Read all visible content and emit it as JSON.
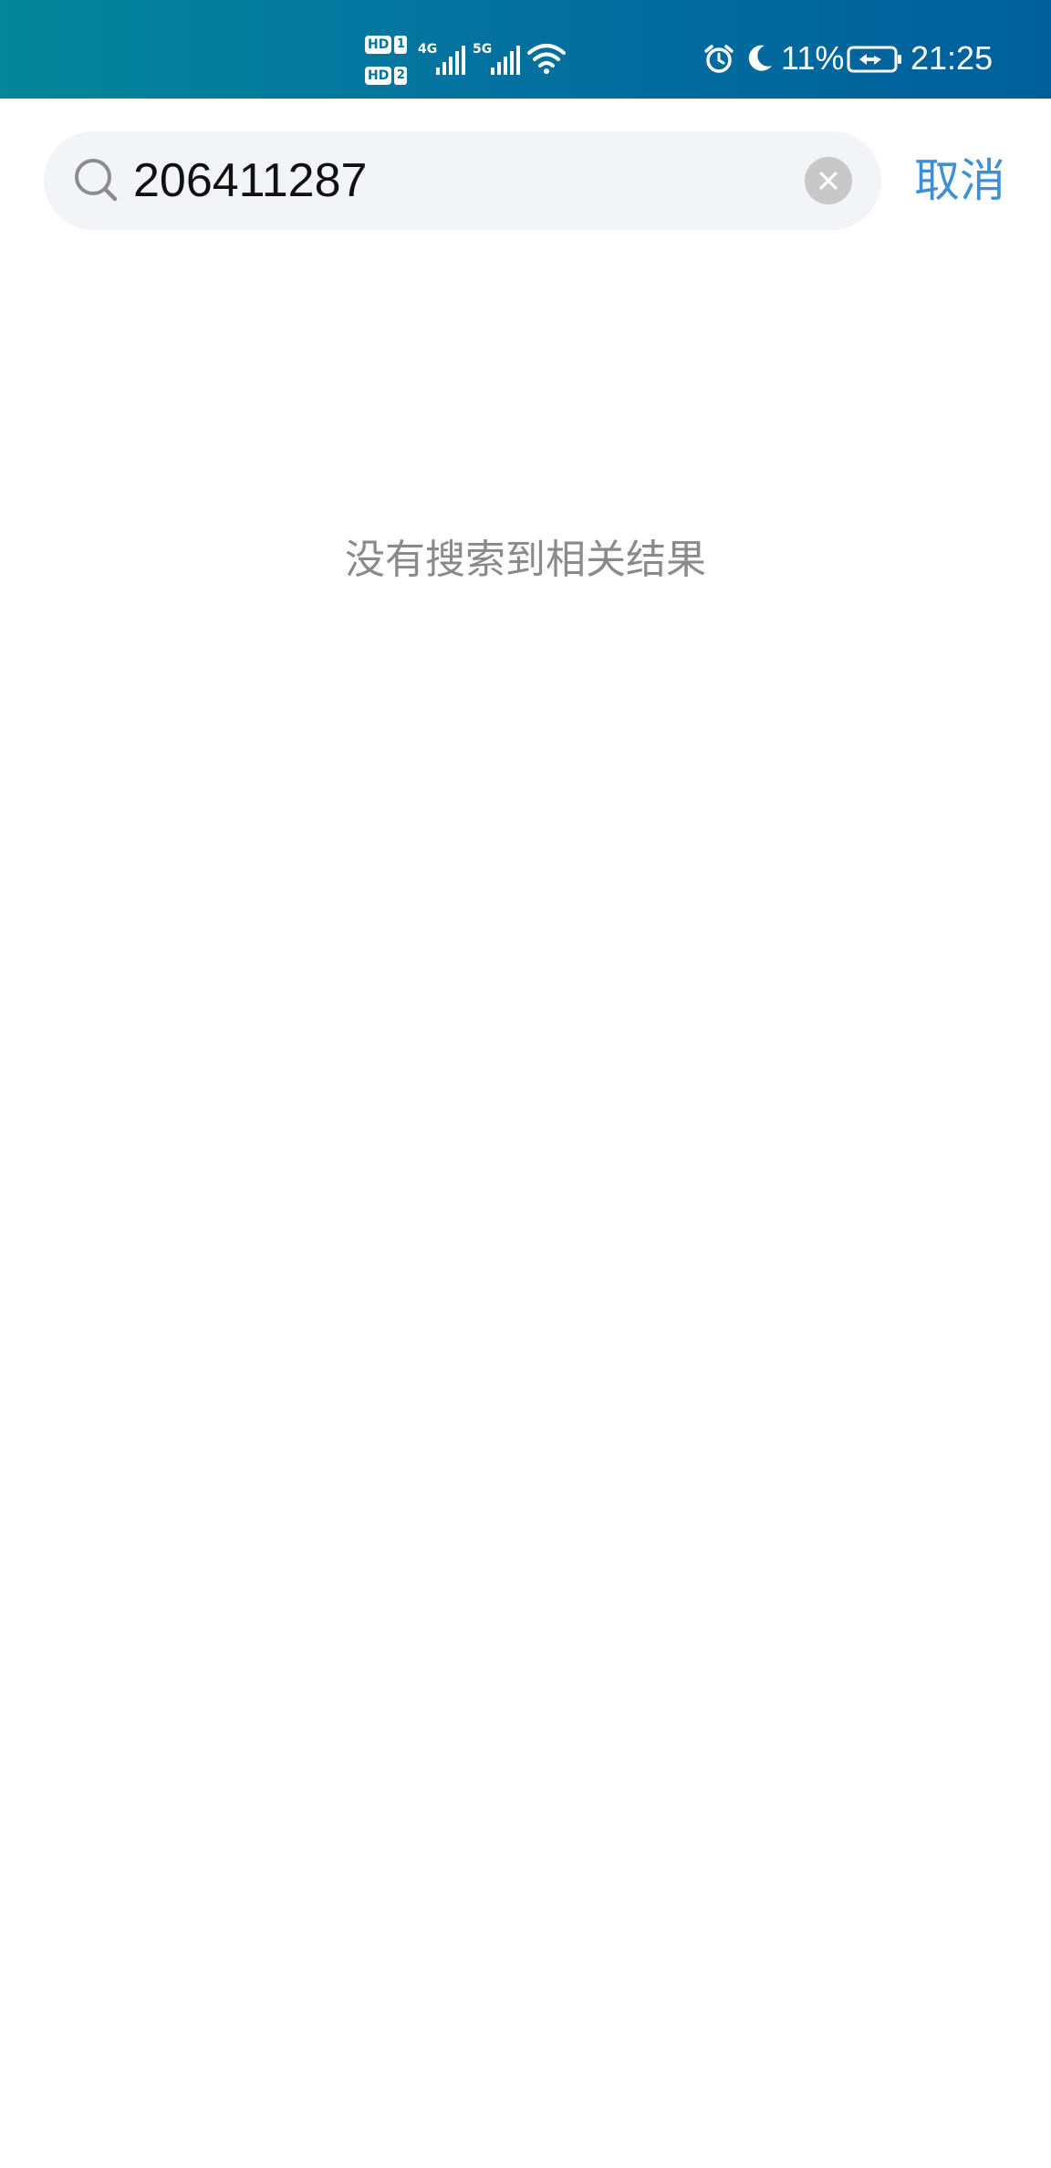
{
  "status_bar": {
    "sim1_label": "HD",
    "sim1_num": "1",
    "sim2_label": "HD",
    "sim2_num": "2",
    "sim1_network": "4G",
    "sim2_network": "5G",
    "battery_percent": "11%",
    "time": "21:25",
    "icons": [
      "signal-icon",
      "wifi-icon",
      "alarm-icon",
      "moon-icon",
      "battery-charging-icon"
    ],
    "colors": {
      "bar_start": "#04879a",
      "bar_end": "#005f9b"
    }
  },
  "search": {
    "value": "206411287",
    "cancel_label": "取消",
    "icon": "search-icon",
    "clear_icon": "close-icon"
  },
  "results": {
    "empty_message": "没有搜索到相关结果"
  },
  "accent_color": "#3f8fd6"
}
